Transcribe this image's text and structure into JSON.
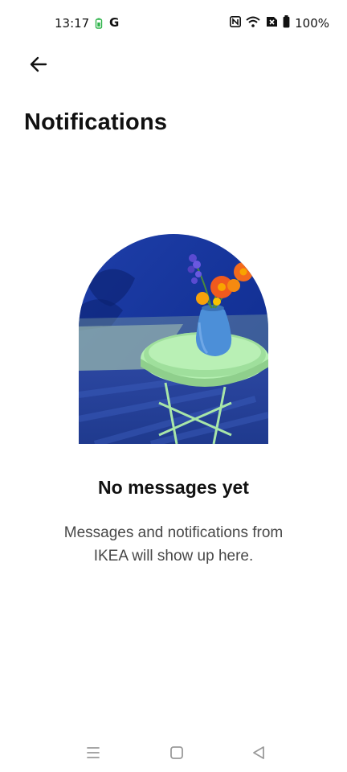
{
  "status_bar": {
    "time": "13:17",
    "carrier_icon": "G",
    "battery_percent": "100%",
    "icons": [
      "nfc-icon",
      "wifi-icon",
      "sim-off-icon",
      "battery-icon"
    ]
  },
  "header": {
    "back_icon": "arrow-left-icon",
    "title": "Notifications"
  },
  "empty_state": {
    "illustration": "arched photo of green side table with blue vase and orange flowers",
    "title": "No messages yet",
    "description": "Messages and notifications from IKEA will show up here."
  },
  "nav_bar": {
    "icons": [
      "menu-icon",
      "home-square-icon",
      "back-triangle-icon"
    ]
  },
  "colors": {
    "background": "#ffffff",
    "text_primary": "#111111",
    "text_secondary": "#484848"
  }
}
